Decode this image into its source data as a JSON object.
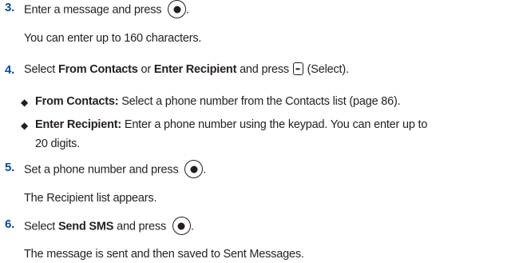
{
  "steps": [
    {
      "number": "3.",
      "text_before": "Enter a message and press",
      "text_after": ".",
      "note": "You can enter up to 160 characters."
    },
    {
      "number": "4.",
      "pre": "Select",
      "opt1": "From Contacts",
      "mid": "or",
      "opt2": "Enter Recipient",
      "post": "and press",
      "after_icon": "(Select).",
      "bullets": [
        {
          "term": "From Contacts:",
          "text": "Select a phone number from the Contacts list (page 86)."
        },
        {
          "term": "Enter Recipient:",
          "text": "Enter a phone number using the keypad. You can enter up to",
          "continuation": "20 digits."
        }
      ]
    },
    {
      "number": "5.",
      "text_before": "Set a phone number and press",
      "text_after": ".",
      "note": "The Recipient list appears."
    },
    {
      "number": "6.",
      "pre": "Select",
      "kw": "Send SMS",
      "post": "and press",
      "text_after": ".",
      "note": "The message is sent and then saved to Sent Messages."
    }
  ],
  "icons": {
    "center_key": "ok-key-icon",
    "left_softkey": "left-softkey-icon",
    "bullet": "diamond-bullet-icon"
  }
}
